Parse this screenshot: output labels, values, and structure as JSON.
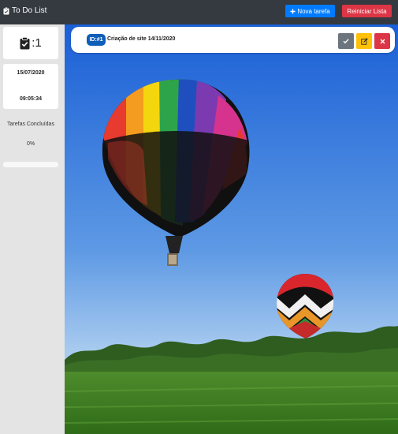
{
  "navbar": {
    "title": "To Do List",
    "brand_icon": "clipboard-check-icon",
    "new_task_label": "Nova tarefa",
    "new_task_icon": "plus-icon",
    "reset_label": "Reiniciar Lista"
  },
  "sidebar": {
    "count_icon": "clipboard-check-icon",
    "count_text": ":1",
    "date": "15/07/2020",
    "time": "09:05:34",
    "done_label": "Tarefas Concluídas",
    "done_percent_text": "0%",
    "progress_fraction": 0
  },
  "task": {
    "id_label": "ID:#1",
    "title": "Criação de site 14/11/2020",
    "actions": [
      {
        "name": "complete",
        "icon": "check-icon"
      },
      {
        "name": "edit",
        "icon": "edit-icon"
      },
      {
        "name": "delete",
        "icon": "close-icon"
      }
    ]
  },
  "colors": {
    "navbar": "#343a40",
    "primary": "#007bff",
    "danger": "#dc3545",
    "warning": "#ffc107",
    "secondary": "#6c757d",
    "badge": "#0e5fb8"
  }
}
